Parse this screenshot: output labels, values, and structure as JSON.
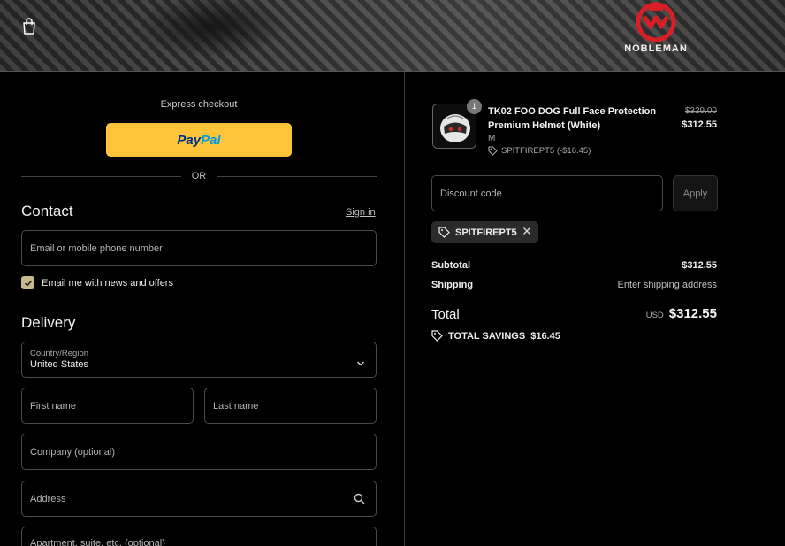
{
  "header": {
    "brand": "NOBLEMAN",
    "icons": {
      "cart": "shopping-bag-icon",
      "logo": "nobleman-logo"
    }
  },
  "express": {
    "label": "Express checkout",
    "paypal_pay": "Pay",
    "paypal_pal": "Pal",
    "or": "OR"
  },
  "contact": {
    "title": "Contact",
    "signin": "Sign in",
    "email_placeholder": "Email or mobile phone number",
    "newsletter_label": "Email me with news and offers",
    "newsletter_checked": true
  },
  "delivery": {
    "title": "Delivery",
    "country_label": "Country/Region",
    "country_value": "United States",
    "first_name_placeholder": "First name",
    "last_name_placeholder": "Last name",
    "company_placeholder": "Company (optional)",
    "address_placeholder": "Address",
    "apartment_placeholder": "Apartment, suite, etc. (optional)"
  },
  "summary": {
    "product": {
      "quantity": "1",
      "name": "TK02 FOO DOG Full Face Protection Premium Helmet (White)",
      "variant": "M",
      "discount_code": "SPITFIREPT5 (-$16.45)",
      "price_original": "$329.00",
      "price_final": "$312.55"
    },
    "discount_placeholder": "Discount code",
    "apply_label": "Apply",
    "applied_code": "SPITFIREPT5",
    "subtotal_label": "Subtotal",
    "subtotal_value": "$312.55",
    "shipping_label": "Shipping",
    "shipping_value": "Enter shipping address",
    "total_label": "Total",
    "total_currency": "USD",
    "total_value": "$312.55",
    "savings_label": "TOTAL SAVINGS",
    "savings_value": "$16.45"
  },
  "colors": {
    "paypal_yellow": "#ffc439",
    "paypal_dark_blue": "#003087",
    "paypal_light_blue": "#009cde",
    "checkbox_accent": "#c9b88d",
    "logo_red": "#d91f26"
  }
}
